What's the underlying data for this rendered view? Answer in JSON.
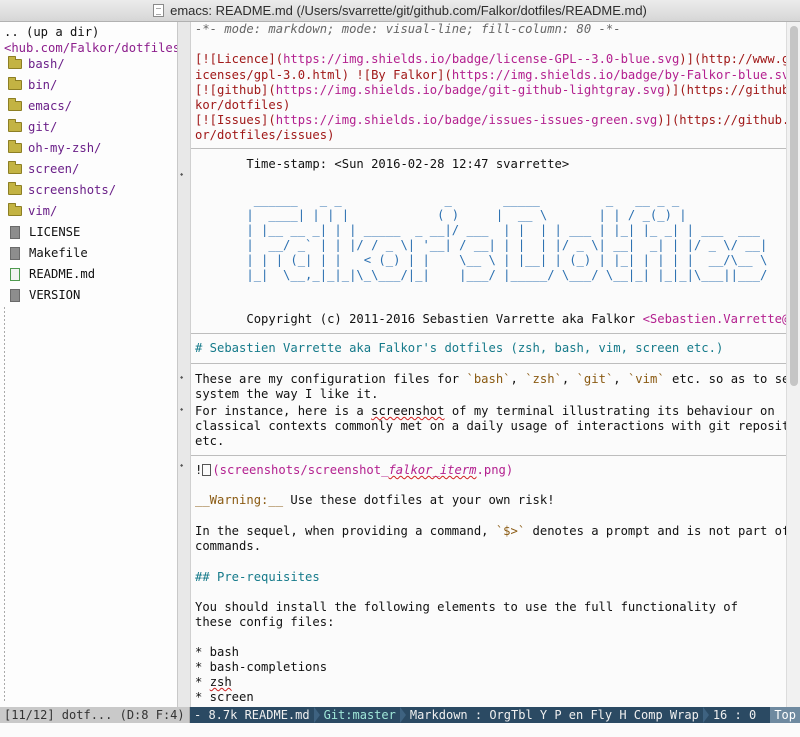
{
  "window": {
    "title": "emacs: README.md (/Users/svarrette/git/github.com/Falkor/dotfiles/README.md)"
  },
  "sidebar": {
    "updir": ".. (up a dir)",
    "path": "<hub.com/Falkor/dotfiles/",
    "dirs": [
      "bash/",
      "bin/",
      "emacs/",
      "git/",
      "oh-my-zsh/",
      "screen/",
      "screenshots/",
      "vim/"
    ],
    "files": [
      "LICENSE",
      "Makefile",
      "README.md",
      "VERSION"
    ]
  },
  "editor": {
    "modeline_comment": "-*- mode: markdown; mode: visual-line; fill-column: 80 -*-",
    "badge1_a": "[![Licence](",
    "badge1_url1": "https://img.shields.io/badge/license-GPL--3.0-blue.svg",
    "badge1_b": ")](http://www.gnu.org/l",
    "badge1_c": "icenses/gpl-3.0.html) ![By Falkor](",
    "badge1_url2": "https://img.shields.io/badge/by-Falkor-blue.svg",
    "badge1_d": ")",
    "badge2_a": "[![github](",
    "badge2_url": "https://img.shields.io/badge/git-github-lightgray.svg",
    "badge2_b": ")](https://github.com/Fal",
    "badge2_c": "kor/dotfiles)",
    "badge3_a": "[![Issues](",
    "badge3_url": "https://img.shields.io/badge/issues-issues-green.svg",
    "badge3_b": ")](https://github.com/Falk",
    "badge3_c": "or/dotfiles/issues)",
    "timestamp": "       Time-stamp: <Sun 2016-02-28 12:47 svarrette>",
    "ascii_art": [
      "        ______   _ _              _       _____         _   __ _ _",
      "       |  ____| | | |            ( )     |  __ \\       | | / _(_) |",
      "       | |__ __ _| | | _____  _ __|/ ___  | |  | | ___ | |_| |_ _| | ___  ___",
      "       |  __/ _` | | |/ / _ \\| '__| / __| | |  | |/ _ \\| __|  _| | |/ _ \\/ __|",
      "       | | | (_| | |   < (_) | |    \\__ \\ | |__| | (_) | |_| | | | |  __/\\__ \\",
      "       |_|  \\__,_|_|_|\\_\\___/|_|    |___/ |_____/ \\___/ \\__|_| |_|_|\\___||___/"
    ],
    "copyright": "       Copyright (c) 2011-2016 Sebastien Varrette aka Falkor ",
    "copyright_mail": "<Sebastien.Varrette@uni.lu>",
    "h1": "# Sebastien Varrette aka Falkor's dotfiles (zsh, bash, vim, screen etc.)",
    "p1_l1_a": "These are my configuration files for ",
    "p1_bash": "`bash`",
    "p1_zsh": "`zsh`",
    "p1_git": "`git`",
    "p1_vim": "`vim`",
    "p1_l1_b": " etc. so as to set up a",
    "p1_l2": "system the way I like it.",
    "p2_l1_a": "For instance, here is a ",
    "p2_l1_word": "screenshot",
    "p2_l1_b": " of my terminal illustrating its behaviour on",
    "p2_l2": "classical contexts commonly met on a daily usage of interactions with git repositories",
    "p2_l3": "etc.",
    "img_bang": "!",
    "img_path_a": "(screenshots/screenshot_",
    "img_path_b": "falkor_iterm",
    "img_path_c": ".png)",
    "warning_a": "__Warning:__",
    "warning_b": " Use these dotfiles at your own risk!",
    "seq_l1_a": "In the sequel, when providing a command, ",
    "seq_prompt": "`$>`",
    "seq_l1_b": " denotes a prompt and is not part of the",
    "seq_l2": "commands.",
    "h2": "## Pre-requisites",
    "pre_l1": "You should install the following elements to use the full functionality of",
    "pre_l2": "these config files:",
    "list": [
      "* bash",
      "* bash-completions",
      "* zsh",
      "* screen"
    ]
  },
  "modeline": {
    "left": "[11/12] dotf... (D:8 F:4)",
    "size_name": "- 8.7k README.md",
    "branch": "Git:master",
    "modes": "Markdown : OrgTbl Y P en Fly H Comp Wrap",
    "position": "16 :  0",
    "top": "Top"
  },
  "icons": {
    "folder": "folder-icon",
    "file": "file-icon",
    "markdown": "markdown-file-icon",
    "doc": "document-icon"
  },
  "colors": {
    "accent": "#2b4a63",
    "link": "#b3208f",
    "header": "#157a8a",
    "text_red": "#a01818"
  }
}
